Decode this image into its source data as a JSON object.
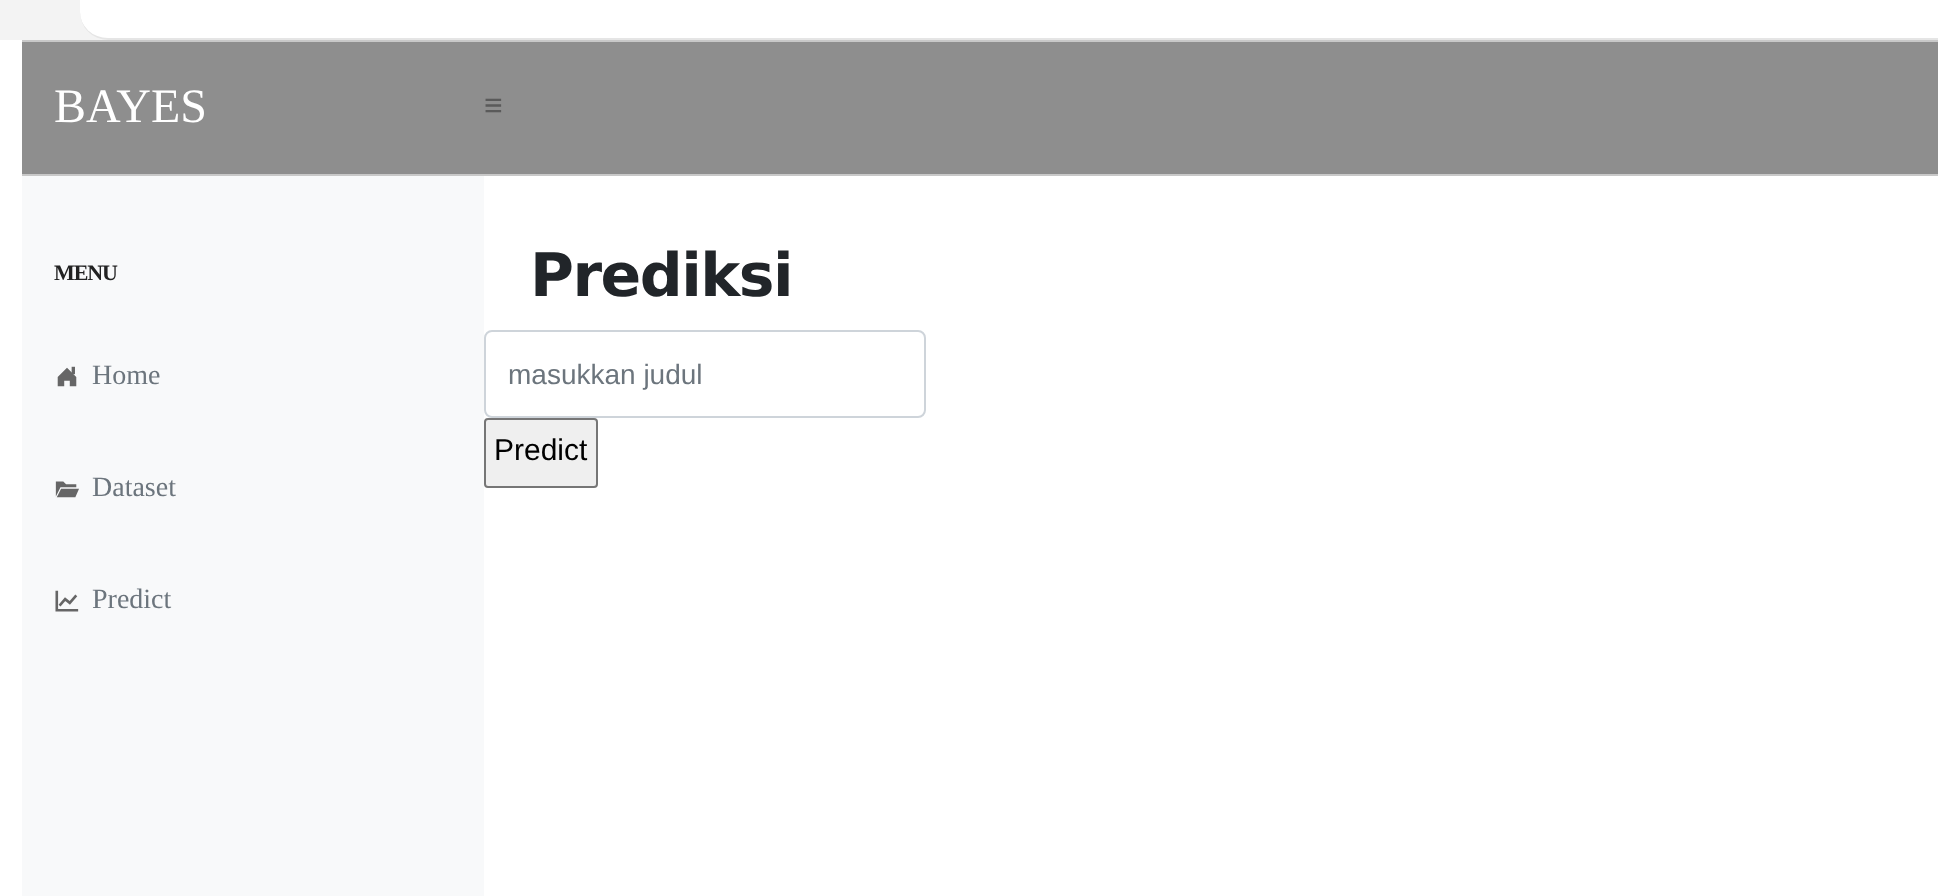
{
  "navbar": {
    "brand": "BAYES",
    "menu_toggle": "≡"
  },
  "sidebar": {
    "heading": "MENU",
    "items": [
      {
        "kind": "home",
        "label": "Home"
      },
      {
        "kind": "folder",
        "label": "Dataset"
      },
      {
        "kind": "chart",
        "label": "Predict"
      }
    ]
  },
  "main": {
    "title": "Prediksi",
    "input": {
      "placeholder": "masukkan judul"
    },
    "button": "Predict"
  }
}
